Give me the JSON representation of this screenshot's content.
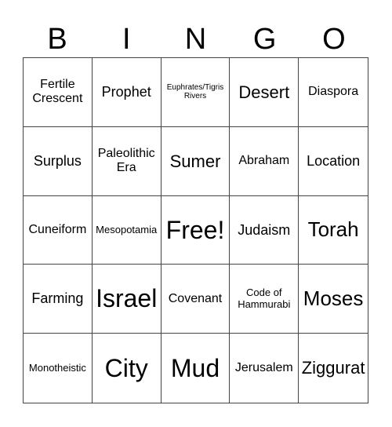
{
  "header": {
    "letters": [
      "B",
      "I",
      "N",
      "G",
      "O"
    ]
  },
  "grid": {
    "rows": [
      [
        "Fertile Crescent",
        "Prophet",
        "Euphrates/Tigris Rivers",
        "Desert",
        "Diaspora"
      ],
      [
        "Surplus",
        "Paleolithic Era",
        "Sumer",
        "Abraham",
        "Location"
      ],
      [
        "Cuneiform",
        "Mesopotamia",
        "Free!",
        "Judaism",
        "Torah"
      ],
      [
        "Farming",
        "Israel",
        "Covenant",
        "Code of Hammurabi",
        "Moses"
      ],
      [
        "Monotheistic",
        "City",
        "Mud",
        "Jerusalem",
        "Ziggurat"
      ]
    ]
  }
}
